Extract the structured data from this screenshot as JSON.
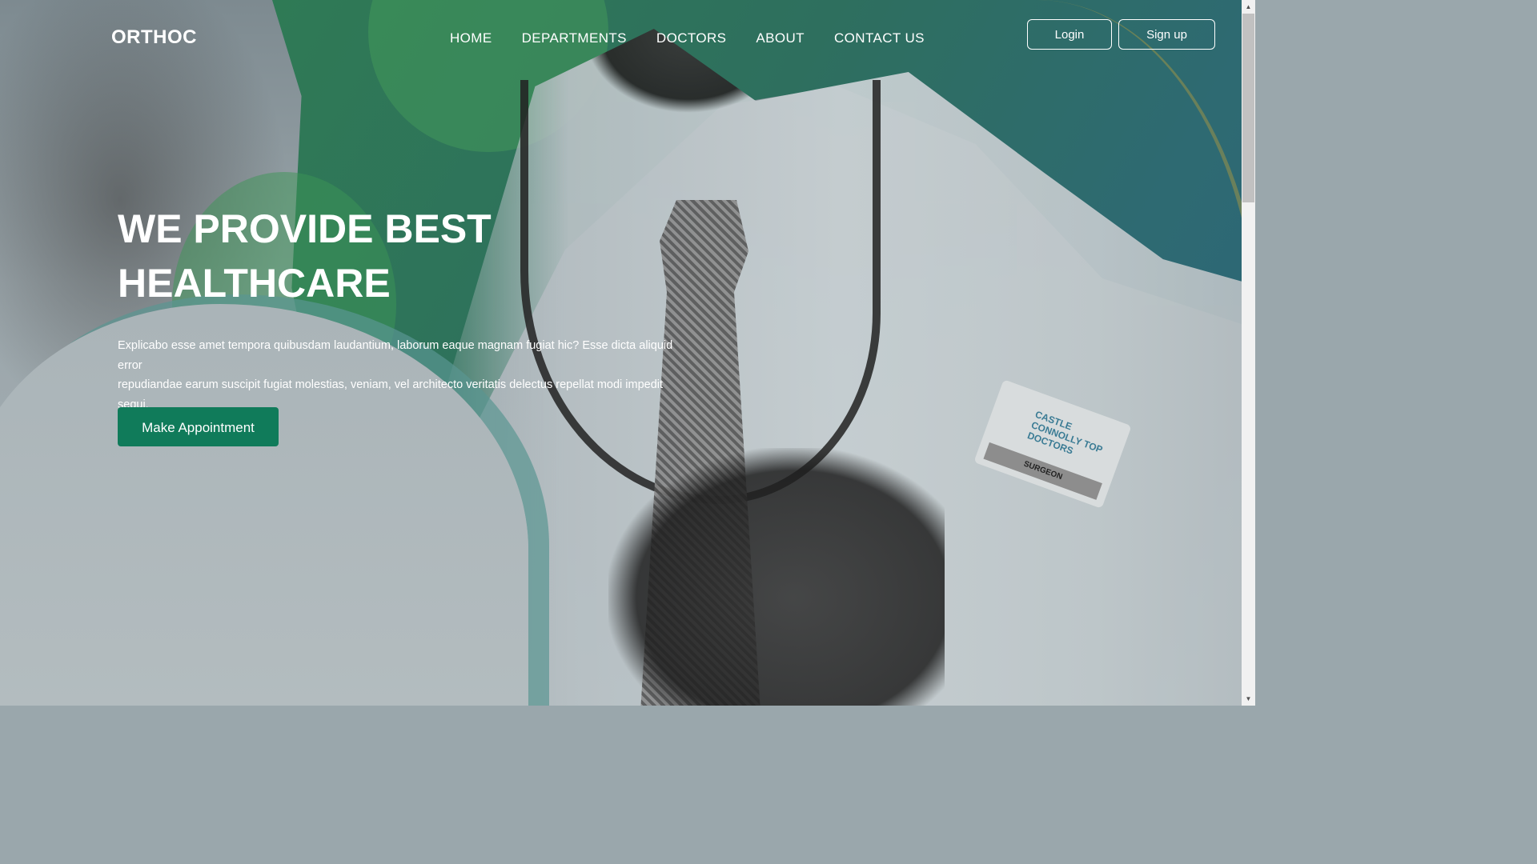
{
  "nav": {
    "logo": "ORTHOC",
    "items": [
      {
        "label": "HOME"
      },
      {
        "label": "DEPARTMENTS"
      },
      {
        "label": "DOCTORS"
      },
      {
        "label": "ABOUT"
      },
      {
        "label": "CONTACT US"
      }
    ],
    "login_label": "Login",
    "signup_label": "Sign up"
  },
  "hero": {
    "title_line1": "WE PROVIDE BEST",
    "title_line2": "HEALTHCARE",
    "description_line1": "Explicabo esse amet tempora quibusdam laudantium, laborum eaque magnam fugiat hic? Esse dicta aliquid error",
    "description_line2": "repudiandae earum suscipit fugiat molestias, veniam, vel architecto veritatis delectus repellat modi impedit sequi.",
    "cta_label": "Make Appointment"
  },
  "photo": {
    "badge_text": "CASTLE CONNOLLY TOP DOCTORS",
    "badge_role": "SURGEON"
  },
  "scrollbar": {
    "up_icon": "▲",
    "down_icon": "▼"
  },
  "colors": {
    "accent": "#107b5a",
    "green_overlay": "#2f7a55",
    "text": "#ffffff"
  }
}
